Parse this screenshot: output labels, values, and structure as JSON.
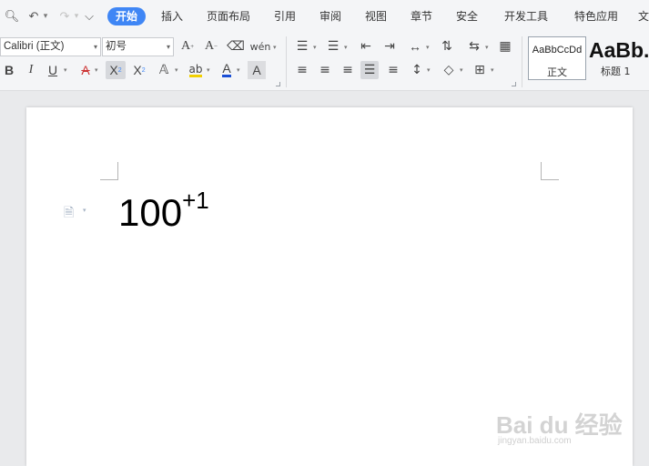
{
  "menu": {
    "tabs": [
      "开始",
      "插入",
      "页面布局",
      "引用",
      "审阅",
      "视图",
      "章节",
      "安全",
      "开发工具",
      "特色应用",
      "文"
    ],
    "active_tab": "开始"
  },
  "ribbon": {
    "font_name": "Calibri (正文)",
    "font_size": "初号",
    "phonetic_label": "wén",
    "styles": [
      {
        "sample": "AaBbCcDd",
        "caption": "正文"
      },
      {
        "sample": "AaBb.",
        "caption": "标题 1"
      }
    ],
    "colors": {
      "accent": "#3f86f5",
      "font_color_underline": "#1a4fd6",
      "highlight": "#f2d000"
    }
  },
  "document": {
    "base_text": "100",
    "superscript_text": "+1"
  },
  "watermark": {
    "logo_text": "Bai du 经验",
    "url": "jingyan.baidu.com"
  }
}
